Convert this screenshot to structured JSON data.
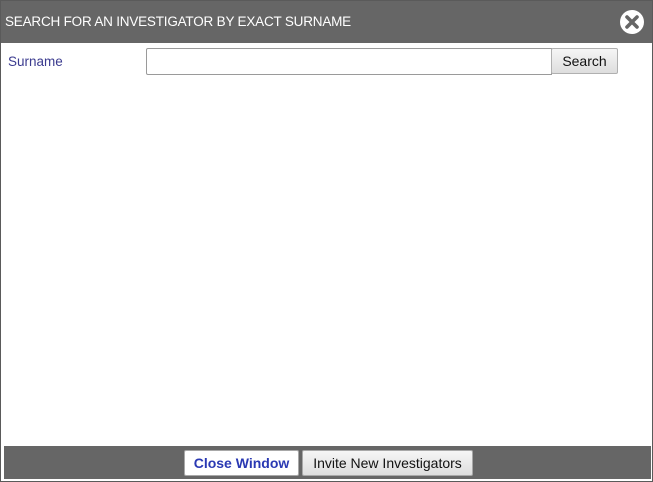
{
  "dialog": {
    "title": "SEARCH FOR AN INVESTIGATOR BY EXACT SURNAME",
    "close_icon": "close-circle-icon"
  },
  "search": {
    "surname_label": "Surname",
    "surname_value": "",
    "surname_placeholder": "",
    "search_button_label": "Search"
  },
  "footer": {
    "close_window_label": "Close Window",
    "invite_label": "Invite New Investigators"
  },
  "colors": {
    "titlebar_bg": "#666666",
    "footer_bg": "#666666",
    "label_text": "#3b3b8f",
    "close_window_text": "#2a39b3"
  }
}
